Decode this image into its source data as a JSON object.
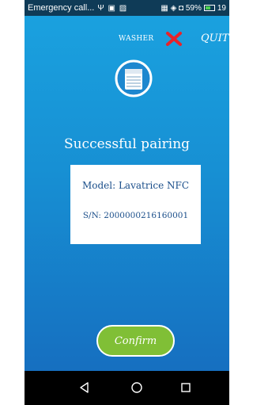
{
  "status_bar": {
    "carrier_text": "Emergency call...",
    "icons_text": "Ψ ▣ ▨",
    "right_text": "▦ ◈ ◘ 59%",
    "time_partial": "19"
  },
  "header": {
    "washer_label": "WASHER",
    "quit_label": "QUIT"
  },
  "title": "Successful pairing",
  "device": {
    "model": "Model: Lavatrice NFC",
    "serial": "S/N: 2000000216160001"
  },
  "confirm_label": "Confirm",
  "colors": {
    "background_top": "#1aa1df",
    "background_bottom": "#166fc0",
    "close_x": "#e8232a",
    "confirm_button": "#80bf36"
  }
}
